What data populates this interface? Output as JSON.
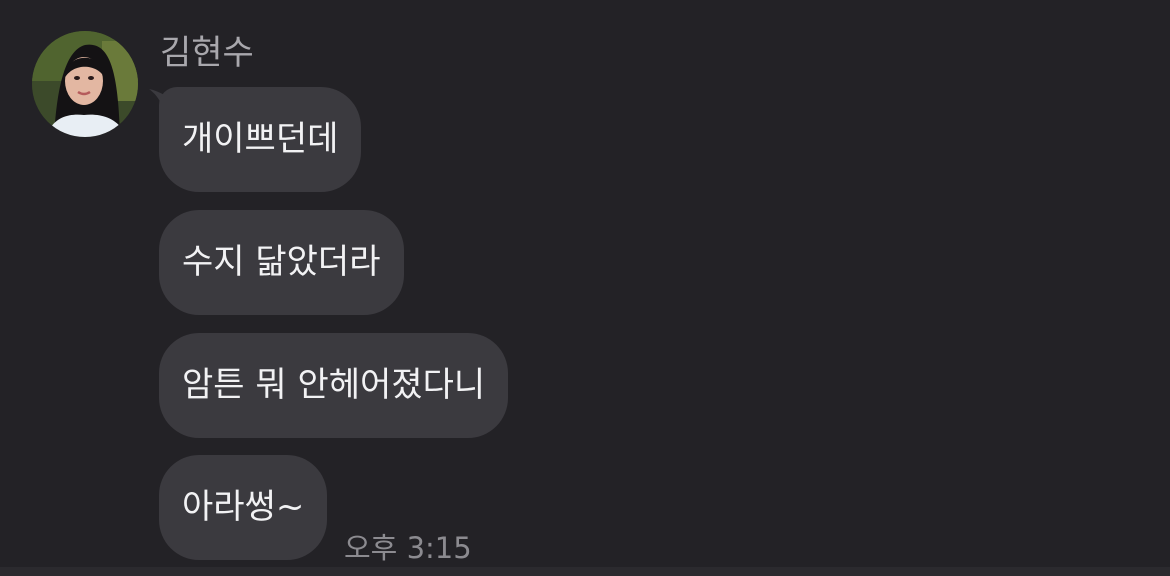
{
  "sender": {
    "name": "김현수"
  },
  "messages": [
    {
      "text": "개이쁘던데"
    },
    {
      "text": "수지 닮았더라"
    },
    {
      "text": "암튼 뭐 안헤어졌다니"
    },
    {
      "text": "아라썽~"
    }
  ],
  "last_message_time": "오후 3:15",
  "colors": {
    "background": "#232226",
    "bubble": "#3b3a3f",
    "bubble_text": "#f2f2f4",
    "sender_name": "#a9a8ad",
    "timestamp": "#8c8b90"
  }
}
